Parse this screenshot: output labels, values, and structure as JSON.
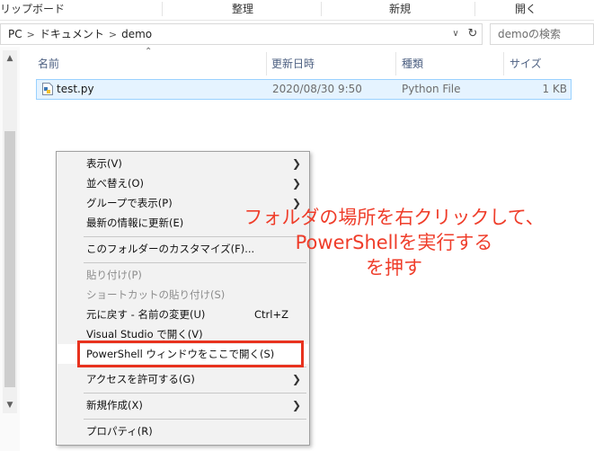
{
  "ribbon": {
    "groups": [
      "リップボード",
      "整理",
      "新規",
      "開く"
    ]
  },
  "address": {
    "crumbs": [
      "PC",
      "ドキュメント",
      "demo"
    ],
    "dropdown_icon": "chevron-down-icon",
    "refresh_icon": "refresh-icon"
  },
  "search": {
    "placeholder": "demoの検索"
  },
  "columns": {
    "name": "名前",
    "modified": "更新日時",
    "type": "種類",
    "size": "サイズ"
  },
  "files": [
    {
      "name": "test.py",
      "modified": "2020/08/30 9:50",
      "type": "Python File",
      "size": "1 KB"
    }
  ],
  "context_menu": {
    "items": {
      "view": "表示(V)",
      "sort": "並べ替え(O)",
      "group": "グループで表示(P)",
      "refresh": "最新の情報に更新(E)",
      "customize": "このフォルダーのカスタマイズ(F)...",
      "paste": "貼り付け(P)",
      "paste_shortcut": "ショートカットの貼り付け(S)",
      "undo": "元に戻す - 名前の変更(U)",
      "undo_shortcut": "Ctrl+Z",
      "open_vs": "Visual Studio で開く(V)",
      "open_powershell": "PowerShell ウィンドウをここで開く(S)",
      "give_access": "アクセスを許可する(G)",
      "new": "新規作成(X)",
      "properties": "プロパティ(R)"
    }
  },
  "annotation": {
    "line1": "フォルダの場所を右クリックして、",
    "line2": "PowerShellを実行する",
    "line3": "を押す",
    "color": "#ef3d2a"
  }
}
